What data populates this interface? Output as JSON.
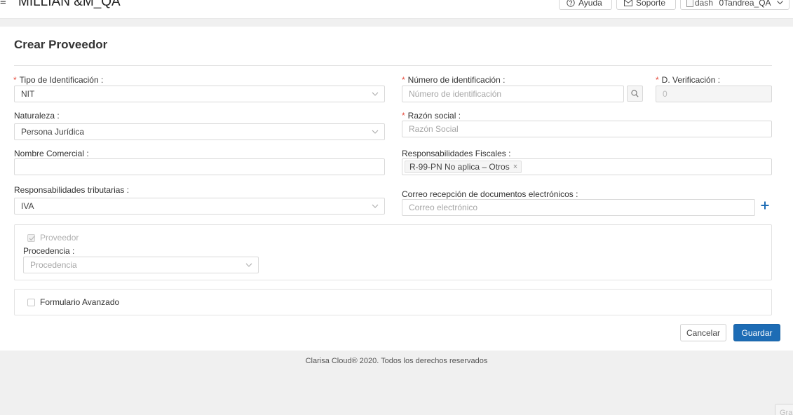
{
  "header": {
    "menu_glyph": "≡",
    "app_title": "MILLIAN &M_QA",
    "help_label": "Ayuda",
    "support_label": "Soporte",
    "avatar_alt": "dash",
    "user_name": "0Tandrea_QA"
  },
  "form": {
    "title": "Crear Proveedor",
    "required_mark": "*",
    "tipo_id": {
      "label": "Tipo de Identificación :",
      "value": "NIT"
    },
    "numero_id": {
      "label": "Número de identificación :",
      "placeholder": "Número de identificación"
    },
    "verificacion": {
      "label": "D. Verificación :",
      "value": "0"
    },
    "naturaleza": {
      "label": "Naturaleza :",
      "value": "Persona Jurídica"
    },
    "razon_social": {
      "label": "Razón social :",
      "placeholder": "Razón Social"
    },
    "nombre_comercial": {
      "label": "Nombre Comercial :",
      "value": ""
    },
    "resp_fiscales": {
      "label": "Responsabilidades Fiscales :",
      "tags": [
        "R-99-PN No aplica – Otros"
      ],
      "tag_close": "×"
    },
    "resp_tributarias": {
      "label": "Responsabilidades tributarias :",
      "value": "IVA"
    },
    "correo": {
      "label": "Correo recepción de documentos electrónicos :",
      "placeholder": "Correo electrónico"
    },
    "proveedor_checkbox": {
      "label": "Proveedor",
      "checked": true,
      "disabled": true
    },
    "procedencia": {
      "label": "Procedencia :",
      "placeholder": "Procedencia"
    },
    "formulario_avanzado": {
      "label": "Formulario Avanzado",
      "checked": false
    },
    "cancel_label": "Cancelar",
    "save_label": "Guardar"
  },
  "footer": {
    "copyright": "Clarisa Cloud® 2020. Todos los derechos reservados",
    "grabar_label": "Grabar"
  },
  "colors": {
    "primary": "#1d6cb5",
    "required": "#e64a3b",
    "accent_icon": "#1d6cb5"
  }
}
